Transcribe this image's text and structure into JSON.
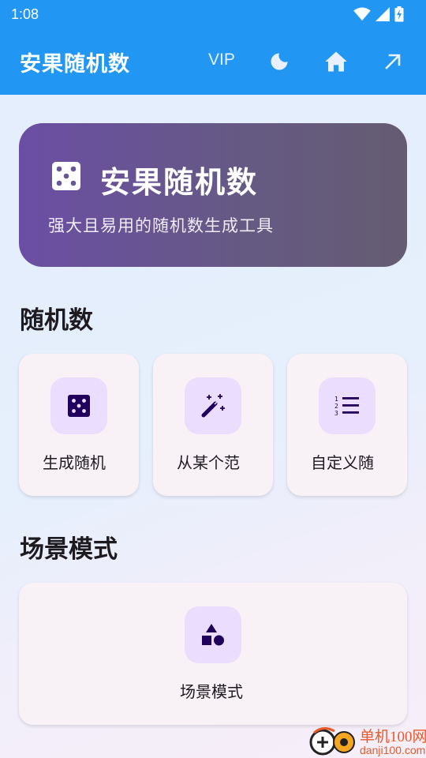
{
  "status_bar": {
    "time": "1:08",
    "icons": [
      "wifi-icon",
      "cell-signal-icon",
      "battery-charging-icon"
    ]
  },
  "app_bar": {
    "title": "安果随机数",
    "vip_label": "VIP",
    "actions": [
      "dark-mode-icon",
      "home-icon",
      "open-external-icon"
    ],
    "background_color": "#2196f3"
  },
  "hero": {
    "title": "安果随机数",
    "subtitle": "强大且易用的随机数生成工具",
    "icon": "dice-icon"
  },
  "sections": {
    "random": {
      "title": "随机数",
      "items": [
        {
          "label": "生成随机",
          "icon": "dice-icon"
        },
        {
          "label": "从某个范",
          "icon": "magic-wand-icon"
        },
        {
          "label": "自定义随",
          "icon": "numbered-list-icon"
        }
      ]
    },
    "scene": {
      "title": "场景模式",
      "items": [
        {
          "label": "场景模式",
          "icon": "shapes-icon"
        }
      ]
    }
  },
  "watermark": {
    "line1": "单机100网",
    "line2": "danji100.com"
  },
  "colors": {
    "accent": "#2196f3",
    "icon_bg": "#eaddfd",
    "icon_fg": "#21005d",
    "card_bg": "#f8f2f7"
  }
}
